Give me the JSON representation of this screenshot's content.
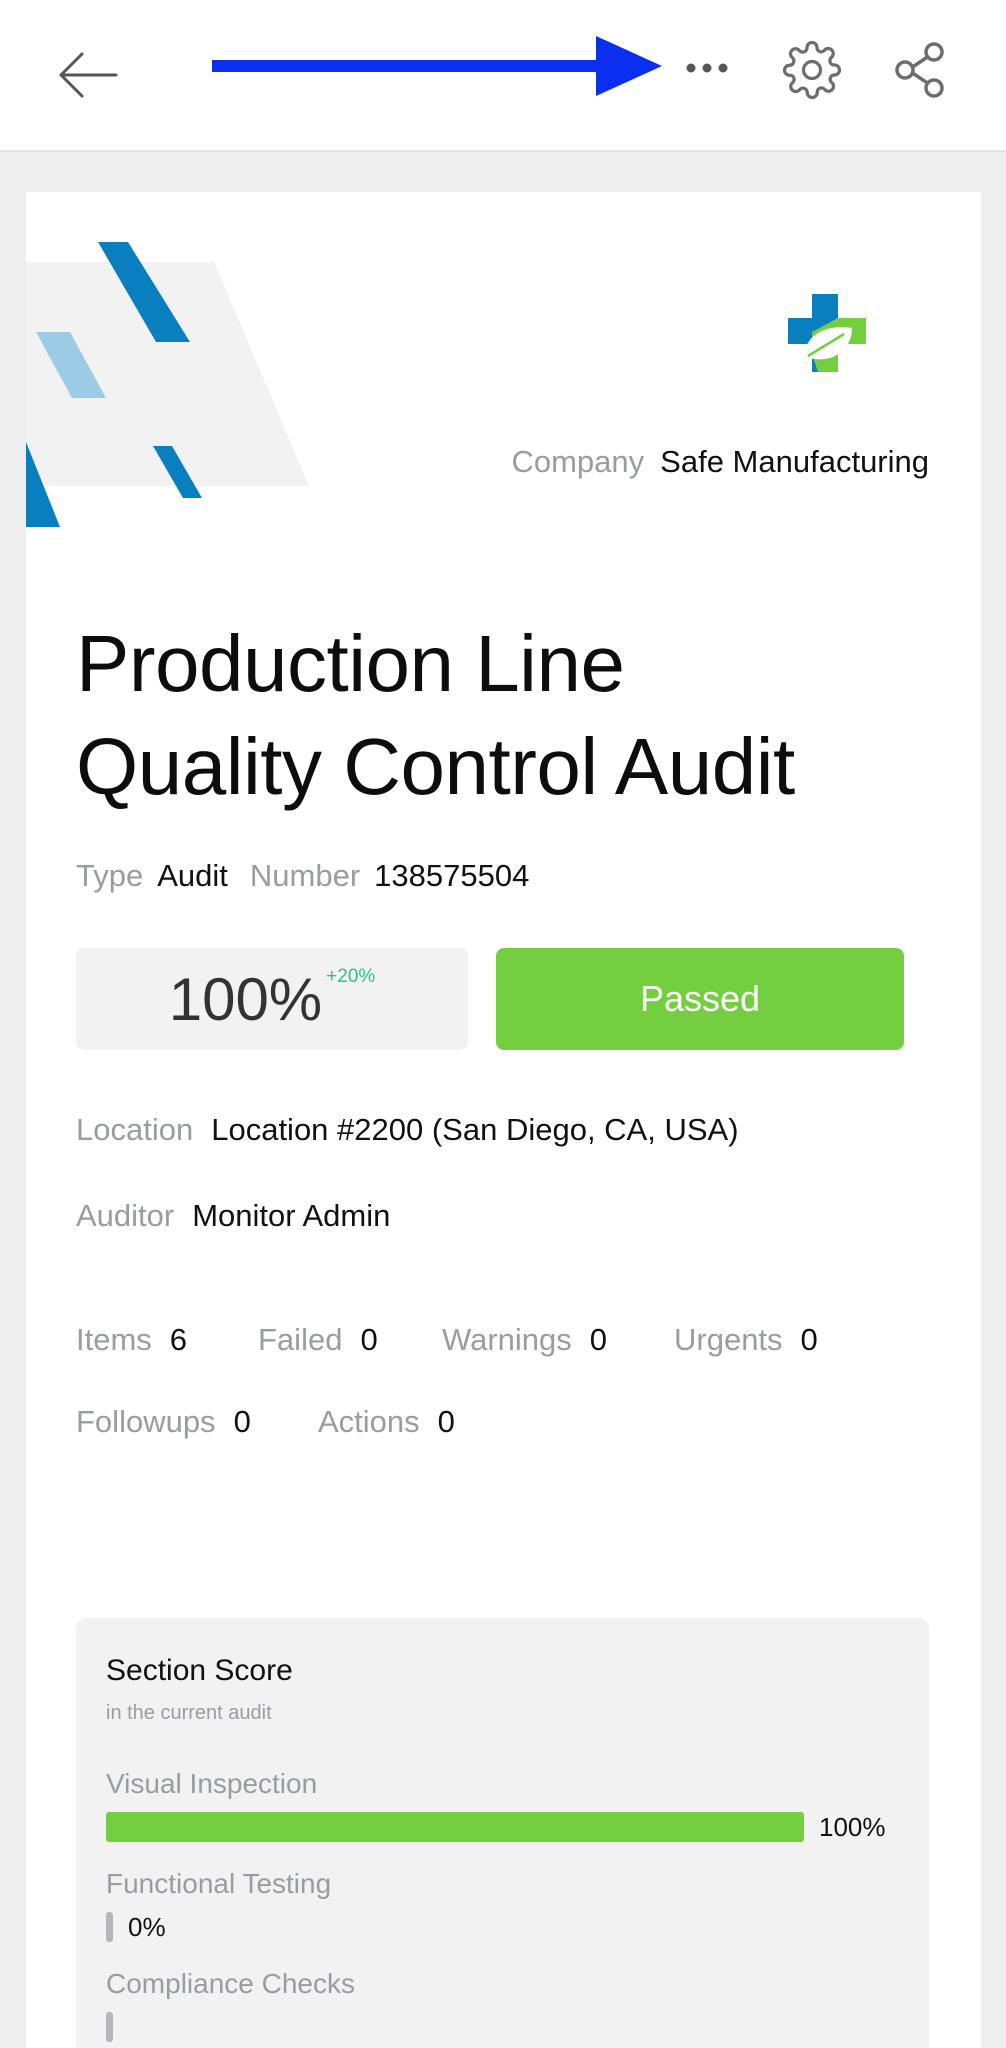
{
  "toolbar": {
    "back_icon": "arrow-left-icon",
    "more_icon": "more-horizontal-icon",
    "settings_icon": "gear-icon",
    "share_icon": "share-icon"
  },
  "colors": {
    "brand_blue": "#0a7fc0",
    "brand_green": "#74cf40",
    "annotation_arrow": "#0a2ff0",
    "delta_green": "#2cc090"
  },
  "report": {
    "company_label": "Company",
    "company_value": "Safe Manufacturing",
    "title_line1": "Production Line",
    "title_line2": "Quality Control Audit",
    "type_label": "Type",
    "type_value": "Audit",
    "number_label": "Number",
    "number_value": "138575504",
    "score": "100%",
    "score_delta": "+20%",
    "result": "Passed",
    "location_label": "Location",
    "location_value": "Location #2200 (San Diego, CA, USA)",
    "auditor_label": "Auditor",
    "auditor_value": "Monitor Admin"
  },
  "stats": [
    {
      "label": "Items",
      "value": "6"
    },
    {
      "label": "Failed",
      "value": "0"
    },
    {
      "label": "Warnings",
      "value": "0"
    },
    {
      "label": "Urgents",
      "value": "0"
    },
    {
      "label": "Followups",
      "value": "0"
    },
    {
      "label": "Actions",
      "value": "0"
    }
  ],
  "section_score": {
    "title": "Section Score",
    "subtitle": "in the current audit",
    "sections": [
      {
        "name": "Visual Inspection",
        "percent": 100,
        "label": "100%"
      },
      {
        "name": "Functional Testing",
        "percent": 0,
        "label": "0%"
      },
      {
        "name": "Compliance Checks",
        "percent": 0,
        "label": ""
      }
    ]
  }
}
